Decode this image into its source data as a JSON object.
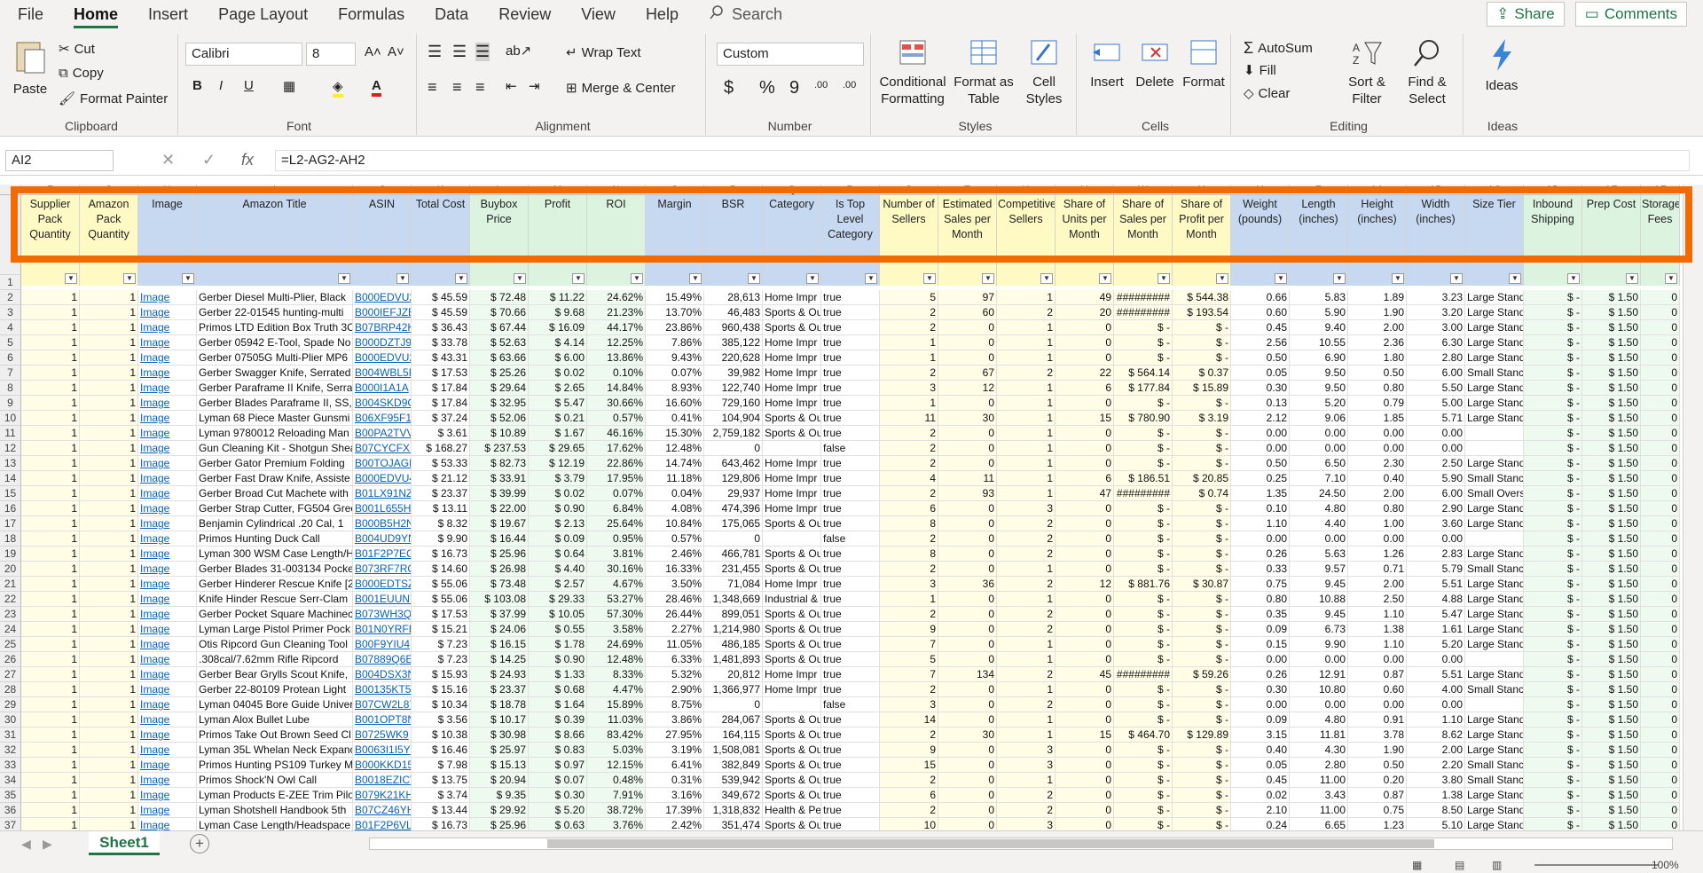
{
  "menu": {
    "tabs": [
      "File",
      "Home",
      "Insert",
      "Page Layout",
      "Formulas",
      "Data",
      "Review",
      "View",
      "Help"
    ],
    "active": "Home",
    "search": "Search",
    "share": "Share",
    "comments": "Comments"
  },
  "ribbon": {
    "clipboard": {
      "label": "Clipboard",
      "paste": "Paste",
      "cut": "Cut",
      "copy": "Copy",
      "format_painter": "Format Painter"
    },
    "font": {
      "label": "Font",
      "name": "Calibri",
      "size": "8",
      "bold": "B",
      "italic": "I",
      "underline": "U"
    },
    "alignment": {
      "label": "Alignment",
      "wrap": "Wrap Text",
      "merge": "Merge & Center"
    },
    "number": {
      "label": "Number",
      "format": "Custom",
      "currency": "$",
      "percent": "%",
      "comma": "9",
      "inc": ".00",
      "dec": ".00"
    },
    "styles": {
      "label": "Styles",
      "cond": "Conditional Formatting",
      "table": "Format as Table",
      "cell": "Cell Styles"
    },
    "cells": {
      "label": "Cells",
      "insert": "Insert",
      "delete": "Delete",
      "format": "Format"
    },
    "editing": {
      "label": "Editing",
      "autosum": "AutoSum",
      "fill": "Fill",
      "clear": "Clear",
      "sort": "Sort & Filter",
      "find": "Find & Select"
    },
    "ideas": {
      "label": "Ideas",
      "ideas": "Ideas"
    }
  },
  "formula_bar": {
    "name_box": "AI2",
    "formula": "=L2-AG2-AH2"
  },
  "columns": [
    {
      "letter": "F",
      "w": 66,
      "head": "Supplier Pack Quantity",
      "bg": "#fff9c4"
    },
    {
      "letter": "G",
      "w": 66,
      "head": "Amazon Pack Quantity",
      "bg": "#fff9c4"
    },
    {
      "letter": "H",
      "w": 66,
      "head": "Image",
      "bg": "#c6d9f1"
    },
    {
      "letter": "I",
      "w": 176,
      "head": "Amazon Title",
      "bg": "#c6d9f1"
    },
    {
      "letter": "J",
      "w": 66,
      "head": "ASIN",
      "bg": "#c6d9f1"
    },
    {
      "letter": "K",
      "w": 66,
      "head": "Total Cost",
      "bg": "#c6d9f1"
    },
    {
      "letter": "L",
      "w": 66,
      "head": "Buybox Price",
      "bg": "#dcf3df"
    },
    {
      "letter": "M",
      "w": 66,
      "head": "Profit",
      "bg": "#dcf3df"
    },
    {
      "letter": "N",
      "w": 66,
      "head": "ROI",
      "bg": "#dcf3df"
    },
    {
      "letter": "O",
      "w": 66,
      "head": "Margin",
      "bg": "#c6d9f1"
    },
    {
      "letter": "P",
      "w": 66,
      "head": "BSR",
      "bg": "#c6d9f1"
    },
    {
      "letter": "Q",
      "w": 66,
      "head": "Category",
      "bg": "#c6d9f1"
    },
    {
      "letter": "R",
      "w": 66,
      "head": "Is Top Level Category",
      "bg": "#c6d9f1"
    },
    {
      "letter": "S",
      "w": 66,
      "head": "Number of Sellers",
      "bg": "#fff9c4"
    },
    {
      "letter": "T",
      "w": 66,
      "head": "Estimated Sales per Month",
      "bg": "#fff9c4"
    },
    {
      "letter": "U",
      "w": 66,
      "head": "Competitive Sellers",
      "bg": "#fff9c4"
    },
    {
      "letter": "V",
      "w": 66,
      "head": "Share of Units per Month",
      "bg": "#fff9c4"
    },
    {
      "letter": "W",
      "w": 66,
      "head": "Share of Sales per Month",
      "bg": "#fff9c4"
    },
    {
      "letter": "X",
      "w": 66,
      "head": "Share of Profit per Month",
      "bg": "#fff9c4"
    },
    {
      "letter": "Y",
      "w": 66,
      "head": "Weight (pounds)",
      "bg": "#c6d9f1"
    },
    {
      "letter": "Z",
      "w": 66,
      "head": "Length (inches)",
      "bg": "#c6d9f1"
    },
    {
      "letter": "AA",
      "w": 66,
      "head": "Height (inches)",
      "bg": "#c6d9f1"
    },
    {
      "letter": "AB",
      "w": 66,
      "head": "Width (inches)",
      "bg": "#c6d9f1"
    },
    {
      "letter": "AC",
      "w": 66,
      "head": "Size Tier",
      "bg": "#c6d9f1"
    },
    {
      "letter": "AD",
      "w": 66,
      "head": "Inbound Shipping",
      "bg": "#dcf3df"
    },
    {
      "letter": "AE",
      "w": 66,
      "head": "Prep Cost",
      "bg": "#dcf3df"
    },
    {
      "letter": "AF",
      "w": 44,
      "head": "Storage Fees",
      "bg": "#dcf3df"
    }
  ],
  "rows": [
    [
      "1",
      "1",
      "Image",
      "Gerber Diesel Multi-Plier, Black",
      "B000EDVU2",
      "$ 45.59",
      "$ 72.48",
      "$ 11.22",
      "24.62%",
      "15.49%",
      "28,613",
      "Home Impr",
      "true",
      "5",
      "97",
      "1",
      "49",
      "#########",
      "$ 544.38",
      "0.66",
      "5.83",
      "1.89",
      "3.23",
      "Large Stand",
      "$ -",
      "$ 1.50",
      "0"
    ],
    [
      "1",
      "1",
      "Image",
      "Gerber 22-01545 hunting-multi",
      "B000IEFJZE",
      "$ 45.59",
      "$ 70.66",
      "$ 9.68",
      "21.23%",
      "13.70%",
      "46,483",
      "Sports & Ou",
      "true",
      "2",
      "60",
      "2",
      "20",
      "#########",
      "$ 193.54",
      "0.60",
      "5.90",
      "1.90",
      "3.20",
      "Large Stand",
      "$ -",
      "$ 1.50",
      "0"
    ],
    [
      "1",
      "1",
      "Image",
      "Primos LTD Edition Box Truth 3C",
      "B07BRP42K",
      "$ 36.43",
      "$ 67.44",
      "$ 16.09",
      "44.17%",
      "23.86%",
      "960,438",
      "Sports & Ou",
      "true",
      "2",
      "0",
      "1",
      "0",
      "$ -",
      "$ -",
      "0.45",
      "9.40",
      "2.00",
      "3.00",
      "Large Stand",
      "$ -",
      "$ 1.50",
      "0"
    ],
    [
      "1",
      "1",
      "Image",
      "Gerber 05942 E-Tool, Spade No",
      "B000DZTJ9",
      "$ 33.78",
      "$ 52.63",
      "$ 4.14",
      "12.25%",
      "7.86%",
      "385,122",
      "Home Impr",
      "true",
      "1",
      "0",
      "1",
      "0",
      "$ -",
      "$ -",
      "2.56",
      "10.55",
      "2.36",
      "6.30",
      "Large Stand",
      "$ -",
      "$ 1.50",
      "0"
    ],
    [
      "1",
      "1",
      "Image",
      "Gerber 07505G Multi-Plier MP6",
      "B000EDVU2",
      "$ 43.31",
      "$ 63.66",
      "$ 6.00",
      "13.86%",
      "9.43%",
      "220,628",
      "Home Impr",
      "true",
      "1",
      "0",
      "1",
      "0",
      "$ -",
      "$ -",
      "0.50",
      "6.90",
      "1.80",
      "2.80",
      "Large Stand",
      "$ -",
      "$ 1.50",
      "0"
    ],
    [
      "1",
      "1",
      "Image",
      "Gerber Swagger Knife, Serrated",
      "B004WBL5F",
      "$ 17.53",
      "$ 25.26",
      "$ 0.02",
      "0.10%",
      "0.07%",
      "39,982",
      "Home Impr",
      "true",
      "2",
      "67",
      "2",
      "22",
      "$ 564.14",
      "$ 0.37",
      "0.05",
      "9.50",
      "0.50",
      "6.00",
      "Small Stanc",
      "$ -",
      "$ 1.50",
      "0"
    ],
    [
      "1",
      "1",
      "Image",
      "Gerber Paraframe II Knife, Serra",
      "B000I1A1A",
      "$ 17.84",
      "$ 29.64",
      "$ 2.65",
      "14.84%",
      "8.93%",
      "122,740",
      "Home Impr",
      "true",
      "3",
      "12",
      "1",
      "6",
      "$ 177.84",
      "$ 15.89",
      "0.30",
      "9.50",
      "0.80",
      "5.50",
      "Large Stand",
      "$ -",
      "$ 1.50",
      "0"
    ],
    [
      "1",
      "1",
      "Image",
      "Gerber Blades Paraframe II, SS,",
      "B004SKD9G",
      "$ 17.84",
      "$ 32.95",
      "$ 5.47",
      "30.66%",
      "16.60%",
      "729,160",
      "Home Impr",
      "true",
      "1",
      "0",
      "1",
      "0",
      "$ -",
      "$ -",
      "0.13",
      "5.20",
      "0.79",
      "5.00",
      "Large Stand",
      "$ -",
      "$ 1.50",
      "0"
    ],
    [
      "1",
      "1",
      "Image",
      "Lyman 68 Piece Master Gunsmi",
      "B06XF95F1",
      "$ 37.24",
      "$ 52.06",
      "$ 0.21",
      "0.57%",
      "0.41%",
      "104,904",
      "Sports & Ou",
      "true",
      "11",
      "30",
      "1",
      "15",
      "$ 780.90",
      "$ 3.19",
      "2.12",
      "9.06",
      "1.85",
      "5.71",
      "Large Stand",
      "$ -",
      "$ 1.50",
      "0"
    ],
    [
      "1",
      "1",
      "Image",
      "Lyman 9780012 Reloading Man",
      "B00PA2TVV",
      "$ 3.61",
      "$ 10.89",
      "$ 1.67",
      "46.16%",
      "15.30%",
      "2,759,182",
      "Sports & Ou",
      "true",
      "2",
      "0",
      "1",
      "0",
      "$ -",
      "$ -",
      "0.00",
      "0.00",
      "0.00",
      "0.00",
      "",
      "$ -",
      "$ 1.50",
      "0"
    ],
    [
      "1",
      "1",
      "Image",
      "Gun Cleaning Kit - Shotgun Shea",
      "B07CYCFXB",
      "$ 168.27",
      "$ 237.53",
      "$ 29.65",
      "17.62%",
      "12.48%",
      "0",
      "",
      "false",
      "2",
      "0",
      "1",
      "0",
      "$ -",
      "$ -",
      "0.00",
      "0.00",
      "0.00",
      "0.00",
      "",
      "$ -",
      "$ 1.50",
      "0"
    ],
    [
      "1",
      "1",
      "Image",
      "Gerber Gator Premium Folding",
      "B00TOJAGB",
      "$ 53.33",
      "$ 82.73",
      "$ 12.19",
      "22.86%",
      "14.74%",
      "643,462",
      "Home Impr",
      "true",
      "2",
      "0",
      "1",
      "0",
      "$ -",
      "$ -",
      "0.50",
      "6.50",
      "2.30",
      "2.50",
      "Large Stand",
      "$ -",
      "$ 1.50",
      "0"
    ],
    [
      "1",
      "1",
      "Image",
      "Gerber Fast Draw Knife, Assiste",
      "B000EDVU4",
      "$ 21.12",
      "$ 33.91",
      "$ 3.79",
      "17.95%",
      "11.18%",
      "129,806",
      "Home Impr",
      "true",
      "4",
      "11",
      "1",
      "6",
      "$ 186.51",
      "$ 20.85",
      "0.25",
      "7.10",
      "0.40",
      "5.90",
      "Small Stanc",
      "$ -",
      "$ 1.50",
      "0"
    ],
    [
      "1",
      "1",
      "Image",
      "Gerber Broad Cut Machete with",
      "B01LX91NZ",
      "$ 23.37",
      "$ 39.99",
      "$ 0.02",
      "0.07%",
      "0.04%",
      "29,937",
      "Home Impr",
      "true",
      "2",
      "93",
      "1",
      "47",
      "#########",
      "$ 0.74",
      "1.35",
      "24.50",
      "2.00",
      "6.00",
      "Small Overs",
      "$ -",
      "$ 1.50",
      "0"
    ],
    [
      "1",
      "1",
      "Image",
      "Gerber Strap Cutter, FG504 Gree",
      "B001L655H",
      "$ 13.11",
      "$ 22.00",
      "$ 0.90",
      "6.84%",
      "4.08%",
      "474,396",
      "Home Impr",
      "true",
      "6",
      "0",
      "3",
      "0",
      "$ -",
      "$ -",
      "0.10",
      "4.80",
      "0.80",
      "2.90",
      "Large Stand",
      "$ -",
      "$ 1.50",
      "0"
    ],
    [
      "1",
      "1",
      "Image",
      "Benjamin Cylindrical .20 Cal, 1",
      "B000B5H2N",
      "$ 8.32",
      "$ 19.67",
      "$ 2.13",
      "25.64%",
      "10.84%",
      "175,065",
      "Sports & Ou",
      "true",
      "8",
      "0",
      "2",
      "0",
      "$ -",
      "$ -",
      "1.10",
      "4.40",
      "1.00",
      "3.60",
      "Large Stand",
      "$ -",
      "$ 1.50",
      "0"
    ],
    [
      "1",
      "1",
      "Image",
      "Primos Hunting Duck Call",
      "B004UD9YN",
      "$ 9.90",
      "$ 16.44",
      "$ 0.09",
      "0.95%",
      "0.57%",
      "0",
      "",
      "false",
      "2",
      "0",
      "2",
      "0",
      "$ -",
      "$ -",
      "0.00",
      "0.00",
      "0.00",
      "0.00",
      "",
      "$ -",
      "$ 1.50",
      "0"
    ],
    [
      "1",
      "1",
      "Image",
      "Lyman 300 WSM Case Length/H",
      "B01F2P7EC",
      "$ 16.73",
      "$ 25.96",
      "$ 0.64",
      "3.81%",
      "2.46%",
      "466,781",
      "Sports & Ou",
      "true",
      "8",
      "0",
      "2",
      "0",
      "$ -",
      "$ -",
      "0.26",
      "5.63",
      "1.26",
      "2.83",
      "Large Stand",
      "$ -",
      "$ 1.50",
      "0"
    ],
    [
      "1",
      "1",
      "Image",
      "Gerber Blades 31-003134 Pocke",
      "B073RF7RQ",
      "$ 14.60",
      "$ 26.98",
      "$ 4.40",
      "30.16%",
      "16.33%",
      "231,455",
      "Sports & Ou",
      "true",
      "2",
      "0",
      "1",
      "0",
      "$ -",
      "$ -",
      "0.33",
      "9.57",
      "0.71",
      "5.79",
      "Small Stanc",
      "$ -",
      "$ 1.50",
      "0"
    ],
    [
      "1",
      "1",
      "Image",
      "Gerber Hinderer Rescue Knife [2",
      "B000EDTSZ",
      "$ 55.06",
      "$ 73.48",
      "$ 2.57",
      "4.67%",
      "3.50%",
      "71,084",
      "Home Impr",
      "true",
      "3",
      "36",
      "2",
      "12",
      "$ 881.76",
      "$ 30.87",
      "0.75",
      "9.45",
      "2.00",
      "5.51",
      "Large Stand",
      "$ -",
      "$ 1.50",
      "0"
    ],
    [
      "1",
      "1",
      "Image",
      "Knife Hinder Rescue Serr-Clam",
      "B001EUUNY",
      "$ 55.06",
      "$ 103.08",
      "$ 29.33",
      "53.27%",
      "28.46%",
      "1,348,669",
      "Industrial &",
      "true",
      "1",
      "0",
      "1",
      "0",
      "$ -",
      "$ -",
      "0.80",
      "10.88",
      "2.50",
      "4.88",
      "Large Stand",
      "$ -",
      "$ 1.50",
      "0"
    ],
    [
      "1",
      "1",
      "Image",
      "Gerber Pocket Square Machinec",
      "B073WH3Q",
      "$ 17.53",
      "$ 37.99",
      "$ 10.05",
      "57.30%",
      "26.44%",
      "899,051",
      "Sports & Ou",
      "true",
      "2",
      "0",
      "2",
      "0",
      "$ -",
      "$ -",
      "0.35",
      "9.45",
      "1.10",
      "5.47",
      "Large Stand",
      "$ -",
      "$ 1.50",
      "0"
    ],
    [
      "1",
      "1",
      "Image",
      "Lyman Large Pistol Primer Pock",
      "B01N0YRFB",
      "$ 15.21",
      "$ 24.06",
      "$ 0.55",
      "3.58%",
      "2.27%",
      "1,214,980",
      "Sports & Ou",
      "true",
      "9",
      "0",
      "2",
      "0",
      "$ -",
      "$ -",
      "0.09",
      "6.73",
      "1.38",
      "1.61",
      "Large Stand",
      "$ -",
      "$ 1.50",
      "0"
    ],
    [
      "1",
      "1",
      "Image",
      "Otis Ripcord Gun Cleaning Tool",
      "B00F9YIU4",
      "$ 7.23",
      "$ 16.15",
      "$ 1.78",
      "24.69%",
      "11.05%",
      "486,185",
      "Sports & Ou",
      "true",
      "7",
      "0",
      "1",
      "0",
      "$ -",
      "$ -",
      "0.15",
      "9.90",
      "1.10",
      "5.20",
      "Large Stand",
      "$ -",
      "$ 1.50",
      "0"
    ],
    [
      "1",
      "1",
      "Image",
      ".308cal/7.62mm Rifle Ripcord",
      "B07889Q6E",
      "$ 7.23",
      "$ 14.25",
      "$ 0.90",
      "12.48%",
      "6.33%",
      "1,481,893",
      "Sports & Ou",
      "true",
      "5",
      "0",
      "1",
      "0",
      "$ -",
      "$ -",
      "0.00",
      "0.00",
      "0.00",
      "0.00",
      "",
      "$ -",
      "$ 1.50",
      "0"
    ],
    [
      "1",
      "1",
      "Image",
      "Gerber Bear Grylls Scout Knife,",
      "B004DSX3N",
      "$ 15.93",
      "$ 24.93",
      "$ 1.33",
      "8.33%",
      "5.32%",
      "20,812",
      "Home Impr",
      "true",
      "7",
      "134",
      "2",
      "45",
      "#########",
      "$ 59.26",
      "0.26",
      "12.91",
      "0.87",
      "5.51",
      "Large Stand",
      "$ -",
      "$ 1.50",
      "0"
    ],
    [
      "1",
      "1",
      "Image",
      "Gerber 22-80109 Protean Light",
      "B00135KT5",
      "$ 15.16",
      "$ 23.37",
      "$ 0.68",
      "4.47%",
      "2.90%",
      "1,366,977",
      "Home Impr",
      "true",
      "2",
      "0",
      "1",
      "0",
      "$ -",
      "$ -",
      "0.30",
      "10.80",
      "0.60",
      "4.00",
      "Small Stanc",
      "$ -",
      "$ 1.50",
      "0"
    ],
    [
      "1",
      "1",
      "Image",
      "Lyman 04045 Bore Guide Univer",
      "B07CW2L87",
      "$ 10.34",
      "$ 18.78",
      "$ 1.64",
      "15.89%",
      "8.75%",
      "0",
      "",
      "false",
      "3",
      "0",
      "2",
      "0",
      "$ -",
      "$ -",
      "0.00",
      "0.00",
      "0.00",
      "0.00",
      "",
      "$ -",
      "$ 1.50",
      "0"
    ],
    [
      "1",
      "1",
      "Image",
      "Lyman Alox Bullet Lube",
      "B001OPT8N",
      "$ 3.56",
      "$ 10.17",
      "$ 0.39",
      "11.03%",
      "3.86%",
      "284,067",
      "Sports & Ou",
      "true",
      "14",
      "0",
      "1",
      "0",
      "$ -",
      "$ -",
      "0.09",
      "4.80",
      "0.91",
      "1.10",
      "Large Stand",
      "$ -",
      "$ 1.50",
      "0"
    ],
    [
      "1",
      "1",
      "Image",
      "Primos Take Out Brown Seed Cl",
      "B0725WK9",
      "$ 10.38",
      "$ 30.98",
      "$ 8.66",
      "83.42%",
      "27.95%",
      "164,115",
      "Sports & Ou",
      "true",
      "2",
      "30",
      "1",
      "15",
      "$ 464.70",
      "$ 129.89",
      "3.15",
      "11.81",
      "3.78",
      "8.62",
      "Large Stand",
      "$ -",
      "$ 1.50",
      "0"
    ],
    [
      "1",
      "1",
      "Image",
      "Lyman 35L Whelan Neck Expanc",
      "B0063I1I5Y",
      "$ 16.46",
      "$ 25.97",
      "$ 0.83",
      "5.03%",
      "3.19%",
      "1,508,081",
      "Sports & Ou",
      "true",
      "9",
      "0",
      "3",
      "0",
      "$ -",
      "$ -",
      "0.40",
      "4.30",
      "1.90",
      "2.00",
      "Large Stand",
      "$ -",
      "$ 1.50",
      "0"
    ],
    [
      "1",
      "1",
      "Image",
      "Primos Hunting PS109 Turkey M",
      "B000KKD15",
      "$ 7.98",
      "$ 15.13",
      "$ 0.97",
      "12.15%",
      "6.41%",
      "382,849",
      "Sports & Ou",
      "true",
      "15",
      "0",
      "3",
      "0",
      "$ -",
      "$ -",
      "0.05",
      "2.80",
      "0.50",
      "2.20",
      "Small Stanc",
      "$ -",
      "$ 1.50",
      "0"
    ],
    [
      "1",
      "1",
      "Image",
      "Primos Shock'N Owl Call",
      "B0018EZICV",
      "$ 13.75",
      "$ 20.94",
      "$ 0.07",
      "0.48%",
      "0.31%",
      "539,942",
      "Sports & Ou",
      "true",
      "2",
      "0",
      "1",
      "0",
      "$ -",
      "$ -",
      "0.45",
      "11.00",
      "0.20",
      "3.80",
      "Small Stanc",
      "$ -",
      "$ 1.50",
      "0"
    ],
    [
      "1",
      "1",
      "Image",
      "Lyman Products E-ZEE Trim Pilot",
      "B079K21KH",
      "$ 3.74",
      "$ 9.35",
      "$ 0.30",
      "7.91%",
      "3.16%",
      "349,672",
      "Sports & Ou",
      "true",
      "6",
      "0",
      "2",
      "0",
      "$ -",
      "$ -",
      "0.02",
      "3.43",
      "0.87",
      "1.38",
      "Large Stand",
      "$ -",
      "$ 1.50",
      "0"
    ],
    [
      "1",
      "1",
      "Image",
      "Lyman Shotshell Handbook 5th",
      "B07CZ46YH",
      "$ 13.44",
      "$ 29.92",
      "$ 5.20",
      "38.72%",
      "17.39%",
      "1,318,832",
      "Health & Pe",
      "true",
      "2",
      "0",
      "2",
      "0",
      "$ -",
      "$ -",
      "2.10",
      "11.00",
      "0.75",
      "8.50",
      "Large Stand",
      "$ -",
      "$ 1.50",
      "0"
    ],
    [
      "1",
      "1",
      "Image",
      "Lyman Case Length/Headspace",
      "B01F2P6VL",
      "$ 16.73",
      "$ 25.96",
      "$ 0.63",
      "3.76%",
      "2.42%",
      "351,474",
      "Sports & Ou",
      "true",
      "10",
      "0",
      "3",
      "0",
      "$ -",
      "$ -",
      "0.24",
      "6.65",
      "1.23",
      "5.10",
      "Large Stand",
      "$ -",
      "$ 1.50",
      "0"
    ]
  ],
  "sheet": {
    "tab": "Sheet1",
    "add": "+",
    "zoom": "100%"
  },
  "icons": {
    "search": "search-icon",
    "share": "share-icon",
    "comments": "comment-icon"
  }
}
